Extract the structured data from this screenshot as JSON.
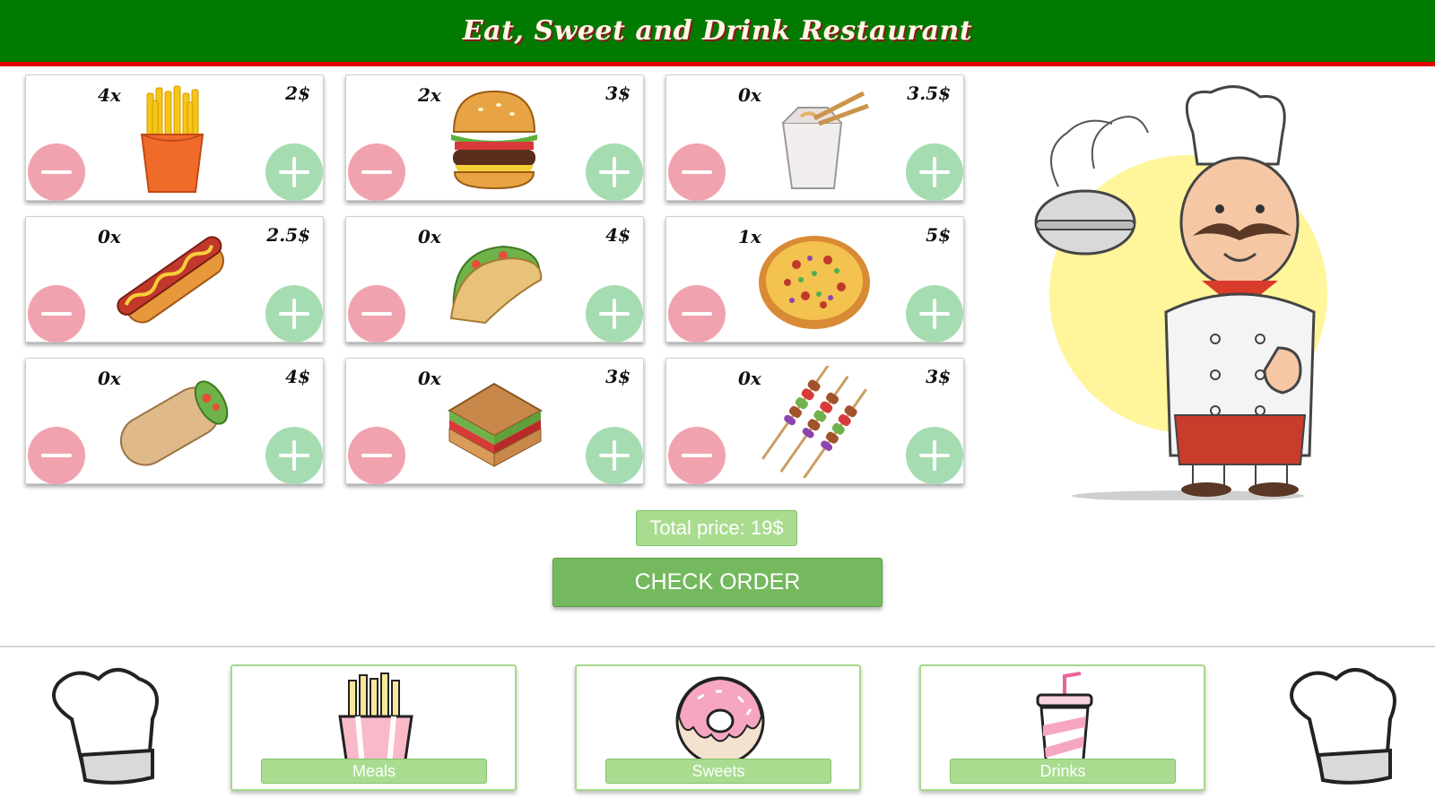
{
  "header": {
    "title": "Eat, Sweet and Drink Restaurant"
  },
  "items": [
    {
      "name": "fries",
      "qty": "4x",
      "price": "2$"
    },
    {
      "name": "burger",
      "qty": "2x",
      "price": "3$"
    },
    {
      "name": "noodles",
      "qty": "0x",
      "price": "3.5$"
    },
    {
      "name": "hotdog",
      "qty": "0x",
      "price": "2.5$"
    },
    {
      "name": "taco",
      "qty": "0x",
      "price": "4$"
    },
    {
      "name": "pizza",
      "qty": "1x",
      "price": "5$"
    },
    {
      "name": "burrito",
      "qty": "0x",
      "price": "4$"
    },
    {
      "name": "sandwich",
      "qty": "0x",
      "price": "3$"
    },
    {
      "name": "kebab",
      "qty": "0x",
      "price": "3$"
    }
  ],
  "total": {
    "label": "Total price: 19$"
  },
  "actions": {
    "check_order": "CHECK ORDER"
  },
  "categories": [
    {
      "label": "Meals",
      "icon": "fries-icon"
    },
    {
      "label": "Sweets",
      "icon": "donut-icon"
    },
    {
      "label": "Drinks",
      "icon": "drink-icon"
    }
  ],
  "colors": {
    "header": "#007a00",
    "header_border": "#e00000",
    "minus": "#f0a3ae",
    "plus": "#a6dcb1",
    "button": "#74b95e"
  }
}
